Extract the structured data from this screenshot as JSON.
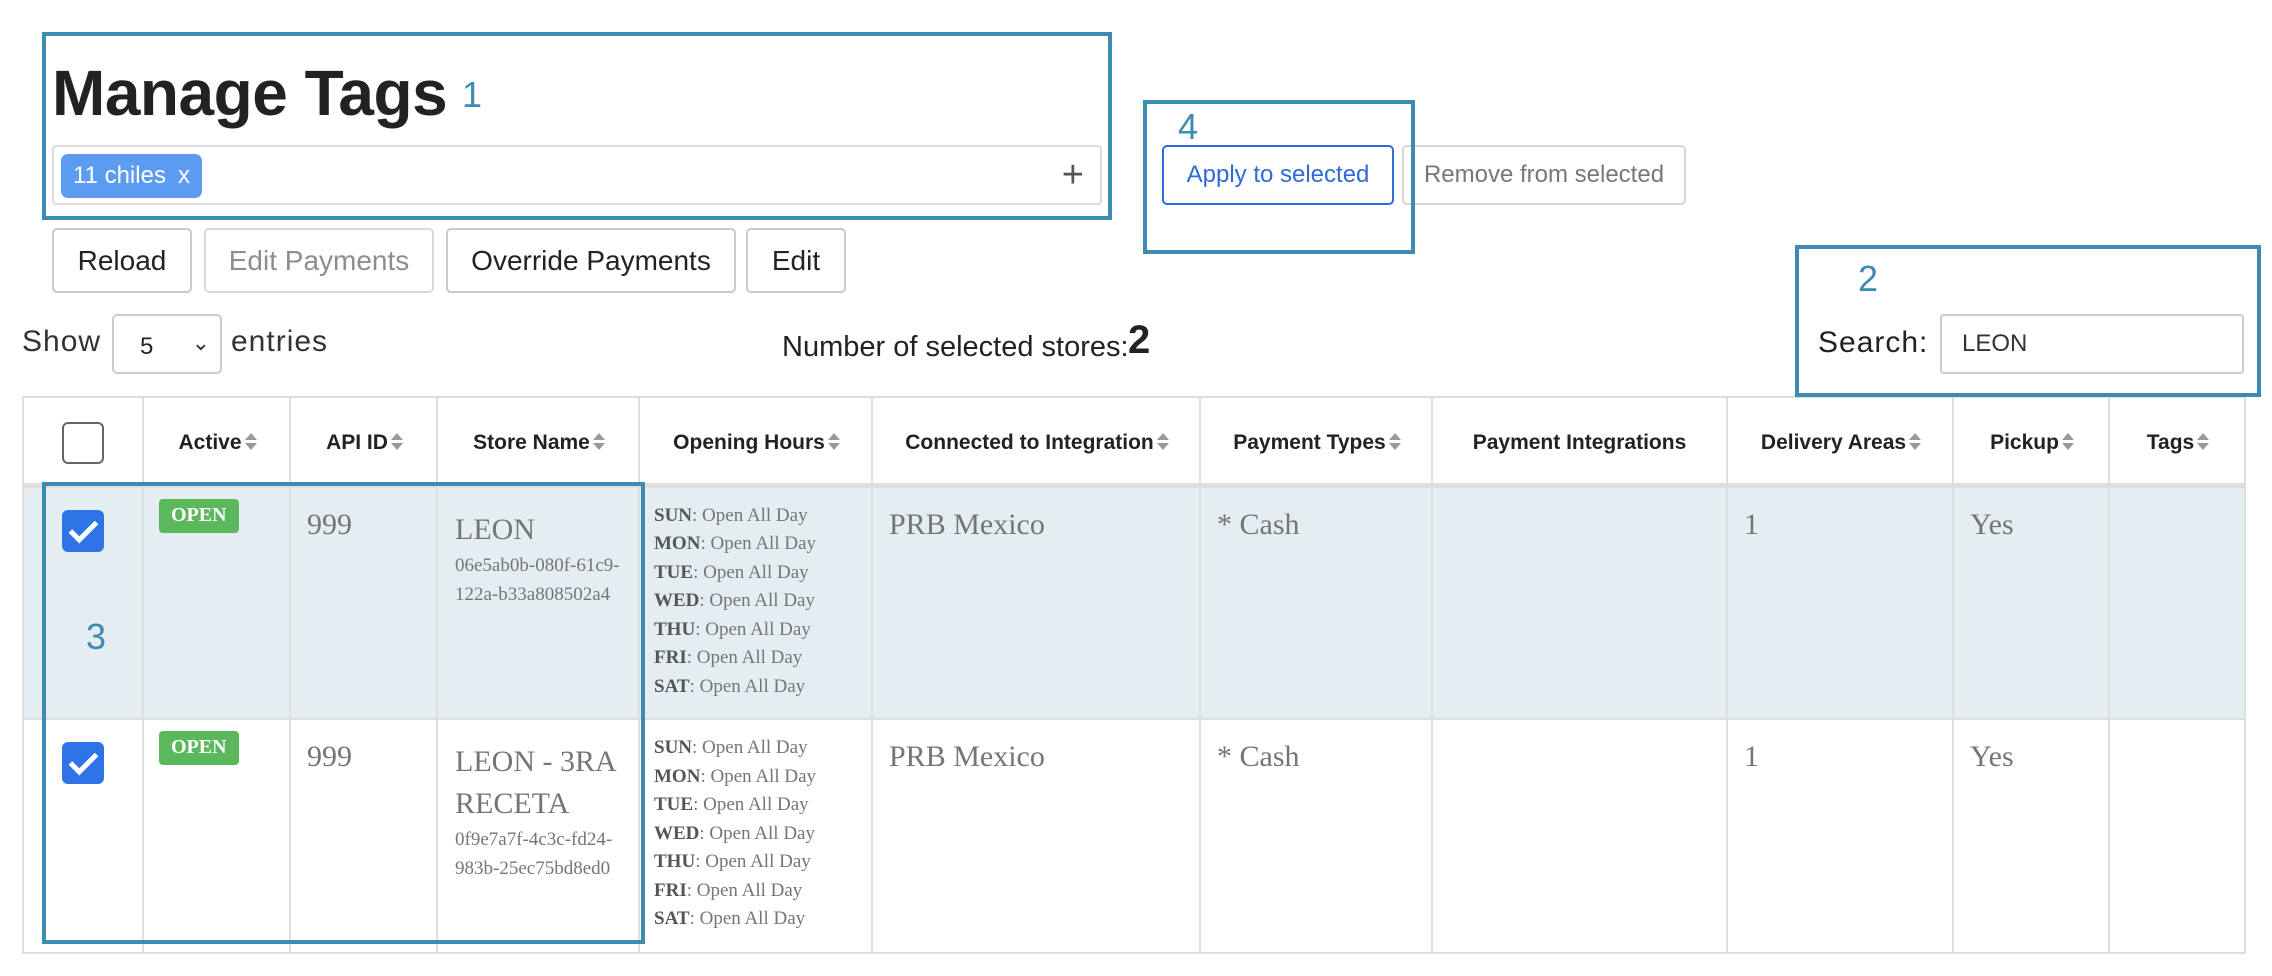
{
  "page": {
    "title": "Manage Tags",
    "tags": [
      {
        "label": "11 chiles",
        "remove": "x"
      }
    ],
    "add_tag": "+"
  },
  "toolbar": {
    "reload": "Reload",
    "edit_payments": "Edit Payments",
    "override_payments": "Override Payments",
    "edit": "Edit"
  },
  "tag_actions": {
    "apply": "Apply to selected",
    "remove": "Remove from selected"
  },
  "length": {
    "show_label": "Show",
    "value": "5",
    "entries_label": "entries"
  },
  "selected": {
    "label": "Number of selected stores:",
    "count": "2"
  },
  "search": {
    "label": "Search:",
    "value": "LEON"
  },
  "annotations": [
    "1",
    "2",
    "3",
    "4"
  ],
  "table": {
    "headers": [
      "Active",
      "API ID",
      "Store Name",
      "Opening Hours",
      "Connected to Integration",
      "Payment Types",
      "Payment Integrations",
      "Delivery Areas",
      "Pickup",
      "Tags"
    ],
    "rows": [
      {
        "checked": true,
        "active": "OPEN",
        "api_id": "999",
        "store_name": "LEON",
        "store_id": "06e5ab0b-080f-61c9-122a-b33a808502a4",
        "hours": [
          {
            "day": "SUN",
            "value": ": Open All Day"
          },
          {
            "day": "MON",
            "value": ": Open All Day"
          },
          {
            "day": "TUE",
            "value": ": Open All Day"
          },
          {
            "day": "WED",
            "value": ": Open All Day"
          },
          {
            "day": "THU",
            "value": ": Open All Day"
          },
          {
            "day": "FRI",
            "value": ": Open All Day"
          },
          {
            "day": "SAT",
            "value": ": Open All Day"
          }
        ],
        "integration": "PRB Mexico",
        "payment_types": "* Cash",
        "payment_integrations": "",
        "delivery_areas": "1",
        "pickup": "Yes",
        "tags": ""
      },
      {
        "checked": true,
        "active": "OPEN",
        "api_id": "999",
        "store_name": "LEON - 3RA RECETA",
        "store_id": "0f9e7a7f-4c3c-fd24-983b-25ec75bd8ed0",
        "hours": [
          {
            "day": "SUN",
            "value": ": Open All Day"
          },
          {
            "day": "MON",
            "value": ": Open All Day"
          },
          {
            "day": "TUE",
            "value": ": Open All Day"
          },
          {
            "day": "WED",
            "value": ": Open All Day"
          },
          {
            "day": "THU",
            "value": ": Open All Day"
          },
          {
            "day": "FRI",
            "value": ": Open All Day"
          },
          {
            "day": "SAT",
            "value": ": Open All Day"
          }
        ],
        "integration": "PRB Mexico",
        "payment_types": "* Cash",
        "payment_integrations": "",
        "delivery_areas": "1",
        "pickup": "Yes",
        "tags": ""
      }
    ]
  },
  "colors": {
    "annotation": "#3d8bb0",
    "primary": "#2e6ad8",
    "tag_chip": "#5b9cf2",
    "open_badge": "#5cb85c",
    "selected_row": "#e4edf2"
  }
}
